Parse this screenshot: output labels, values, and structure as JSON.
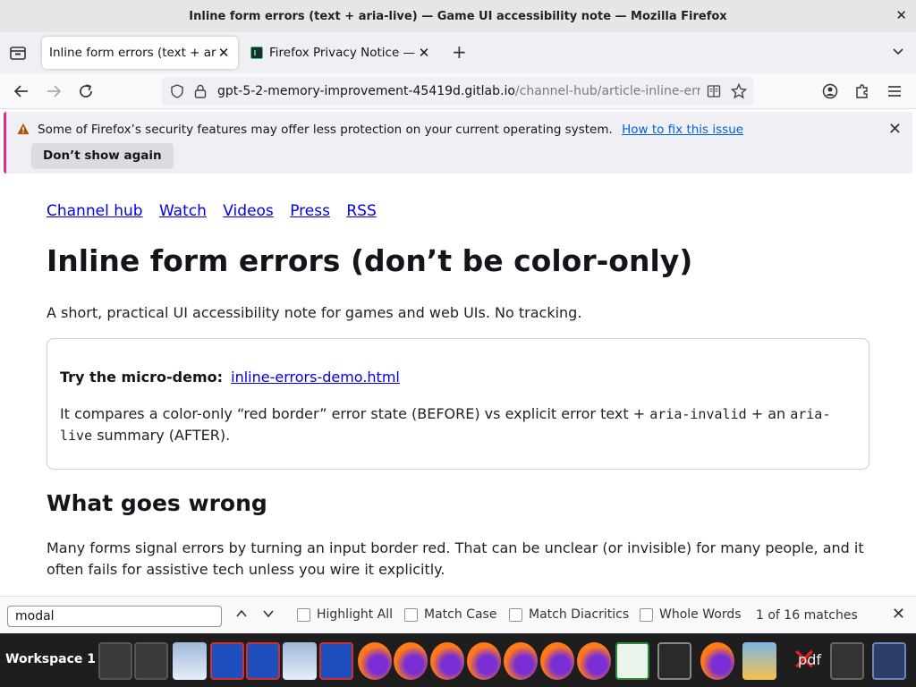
{
  "window": {
    "title": "Inline form errors (text + aria-live) — Game UI accessibility note — Mozilla Firefox"
  },
  "tabs": [
    {
      "label": "Inline form errors (text + aria-live) — Game UI accessibility note",
      "active": true
    },
    {
      "label": "Firefox Privacy Notice — Mozilla",
      "active": false
    }
  ],
  "url": {
    "host": "gpt-5-2-memory-improvement-45419d.gitlab.io",
    "path": "/channel-hub/article-inline-errors.html"
  },
  "notification": {
    "message": "Some of Firefox’s security features may offer less protection on your current operating system.",
    "link": "How to fix this issue",
    "button": "Don’t show again"
  },
  "page": {
    "nav_links": [
      "Channel hub",
      "Watch",
      "Videos",
      "Press",
      "RSS"
    ],
    "title": "Inline form errors (don’t be color-only)",
    "lede": "A short, practical UI accessibility note for games and web UIs. No tracking.",
    "card": {
      "demo_label": "Try the micro-demo:",
      "demo_link": "inline-errors-demo.html",
      "desc_1": "It compares a color-only “red border” error state (BEFORE) vs explicit error text + ",
      "code_1": "aria-invalid",
      "desc_2": " + an ",
      "code_2": "aria-live",
      "desc_3": " summary (AFTER)."
    },
    "section_heading": "What goes wrong",
    "section_para": "Many forms signal errors by turning an input border red. That can be unclear (or invisible) for many people, and it often fails for assistive tech unless you wire it explicitly."
  },
  "findbar": {
    "query": "modal",
    "options": [
      "Highlight All",
      "Match Case",
      "Match Diacritics",
      "Whole Words"
    ],
    "matches": "1 of 16 matches"
  },
  "taskbar": {
    "workspace": "Workspace 1",
    "pdf_label": "pdf"
  }
}
